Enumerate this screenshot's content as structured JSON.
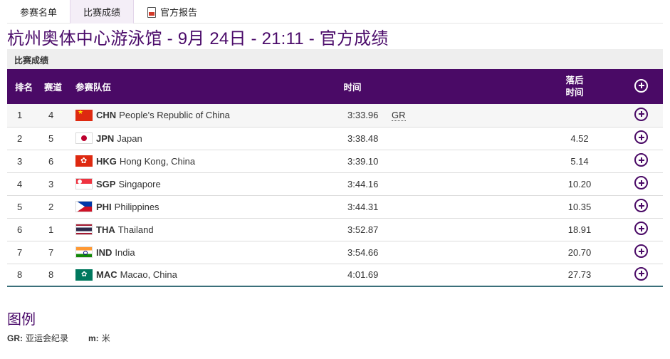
{
  "tabs": [
    {
      "label": "参赛名单",
      "active": false
    },
    {
      "label": "比赛成绩",
      "active": true
    },
    {
      "label": "官方报告",
      "active": false,
      "icon": "pdf-icon"
    }
  ],
  "page_title": "杭州奥体中心游泳馆 - 9月 24日 - 21:11 - 官方成绩",
  "section_label": "比赛成绩",
  "table": {
    "headers": {
      "rank": "排名",
      "lane": "赛道",
      "team": "参赛队伍",
      "time": "时间",
      "behind_line1": "落后",
      "behind_line2": "时间"
    },
    "rows": [
      {
        "rank": "1",
        "lane": "4",
        "flag": "chn",
        "code": "CHN",
        "name": "People's Republic of China",
        "time": "3:33.96",
        "record": "GR",
        "behind": ""
      },
      {
        "rank": "2",
        "lane": "5",
        "flag": "jpn",
        "code": "JPN",
        "name": "Japan",
        "time": "3:38.48",
        "record": "",
        "behind": "4.52"
      },
      {
        "rank": "3",
        "lane": "6",
        "flag": "hkg",
        "code": "HKG",
        "name": "Hong Kong, China",
        "time": "3:39.10",
        "record": "",
        "behind": "5.14"
      },
      {
        "rank": "4",
        "lane": "3",
        "flag": "sgp",
        "code": "SGP",
        "name": "Singapore",
        "time": "3:44.16",
        "record": "",
        "behind": "10.20"
      },
      {
        "rank": "5",
        "lane": "2",
        "flag": "phi",
        "code": "PHI",
        "name": "Philippines",
        "time": "3:44.31",
        "record": "",
        "behind": "10.35"
      },
      {
        "rank": "6",
        "lane": "1",
        "flag": "tha",
        "code": "THA",
        "name": "Thailand",
        "time": "3:52.87",
        "record": "",
        "behind": "18.91"
      },
      {
        "rank": "7",
        "lane": "7",
        "flag": "ind",
        "code": "IND",
        "name": "India",
        "time": "3:54.66",
        "record": "",
        "behind": "20.70"
      },
      {
        "rank": "8",
        "lane": "8",
        "flag": "mac",
        "code": "MAC",
        "name": "Macao, China",
        "time": "4:01.69",
        "record": "",
        "behind": "27.73"
      }
    ]
  },
  "legend": {
    "title": "图例",
    "items": [
      {
        "key": "GR:",
        "value": "亚运会纪录"
      },
      {
        "key": "m:",
        "value": "米"
      }
    ]
  },
  "colors": {
    "accent_purple": "#4a0a66",
    "title_purple": "#4b0b6a",
    "section_bg": "#eeeeee"
  }
}
